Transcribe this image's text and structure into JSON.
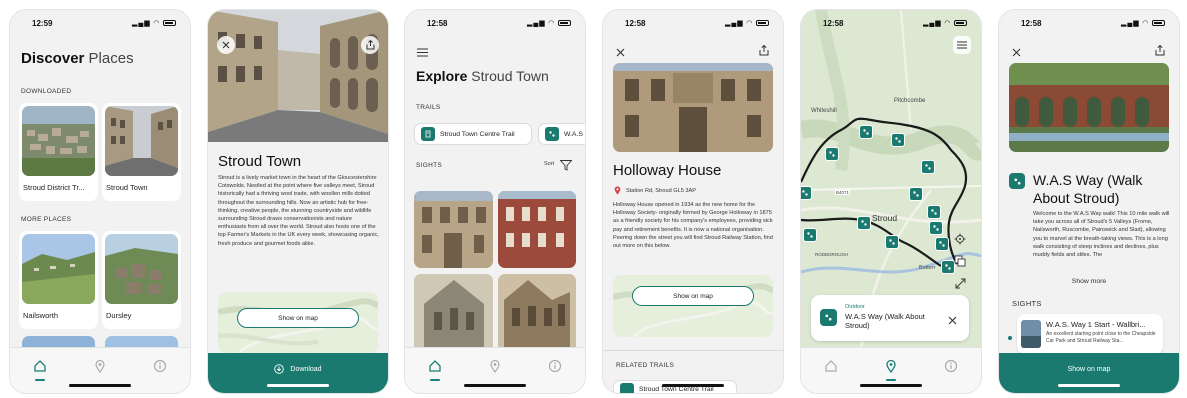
{
  "screens": [
    {
      "time": "12:59",
      "title_bold": "Discover",
      "title_light": "Places",
      "downloaded_label": "DOWNLOADED",
      "downloaded": [
        {
          "label": "Stroud District Tr..."
        },
        {
          "label": "Stroud Town"
        }
      ],
      "more_label": "MORE PLACES",
      "more": [
        {
          "label": "Nailsworth"
        },
        {
          "label": "Dursley"
        }
      ]
    },
    {
      "title": "Stroud Town",
      "description": "Stroud is a lively market town in the heart of the Gloucestershire Cotswolds. Nestled at the point where five valleys meet, Stroud historically had a thriving wool trade, with woollen mills dotted throughout the surrounding hills. Now an artistic hub for free-thinking, creative people, the stunning countryside and wildlife surrounding Stroud draws conservationists and nature enthusiasts from all over the world. Stroud also hosts one of the top Farmer's Markets in the UK every week, showcasing organic, fresh produce and gourmet foods alike.",
      "map_button": "Show on map",
      "download_label": "Download"
    },
    {
      "time": "12:58",
      "title_bold": "Explore",
      "title_light": "Stroud Town",
      "trails_label": "TRAILS",
      "trails": [
        "Stroud Town Centre Trail",
        "W.A.S"
      ],
      "sights_label": "SIGHTS",
      "sort_label": "Sort"
    },
    {
      "time": "12:58",
      "title": "Holloway House",
      "address": "Station Rd, Stroud GL5 3AP",
      "description": "Holloway House opened in 1934 as the new home for the Holloway Society- originally formed by George Holloway in 1875 as a friendly society for his company's employees, providing sick pay and retirement benefits. It is now a national organisation. Peering down the street you will find Stroud Railway Station, find out more on this below.",
      "map_button": "Show on map",
      "related_label": "RELATED TRAILS",
      "related_item": "Stroud Town Centre Trail"
    },
    {
      "time": "12:58",
      "labels": {
        "pitchcombe": "Pitchcombe",
        "whiteshill": "Whiteshill",
        "stroud": "Stroud",
        "road": "B4071",
        "rodborough": "RODBOROUGH",
        "butterrow": "Butterr"
      },
      "card_category": "Outdoor",
      "card_title": "W.A.S Way (Walk About Stroud)"
    },
    {
      "time": "12:58",
      "title": "W.A.S Way (Walk About Stroud)",
      "description": "Welcome to the W.A.S Way walk! This 10 mile walk will take you across all of Stroud's 5 Valleys (Frome, Nailsworth, Ruscombe, Painswick and Slad), allowing you to marvel at the breath-taking views. This is a long walk consisting of steep inclines and declines, plus muddy fields and stiles. The",
      "show_more": "Show more",
      "sights_label": "SIGHTS",
      "sight_title": "W.A.S. Way 1 Start - Wallbri...",
      "sight_desc": "An excellent starting point close to the Cheapside Car Park and Stroud Railway Sta...",
      "map_button": "Show on map"
    }
  ],
  "colors": {
    "accent": "#1b7a70",
    "background": "#f2f2f3"
  }
}
